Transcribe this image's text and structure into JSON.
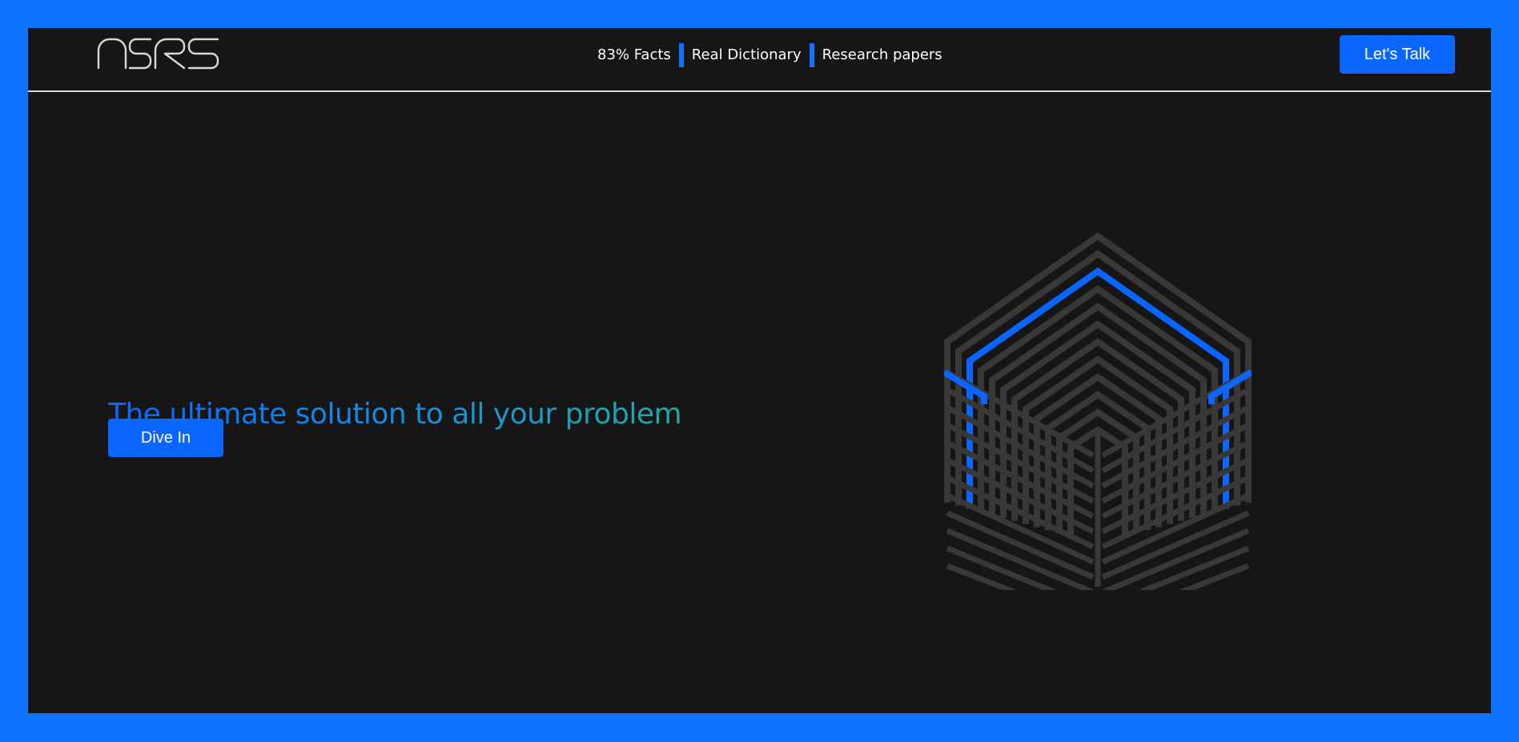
{
  "nav": {
    "logo_text": "NSRS",
    "links": [
      "83% Facts",
      "Real Dictionary",
      "Research papers"
    ],
    "cta_label": "Let's Talk"
  },
  "hero": {
    "headline": "The ultimate solution to all your problem",
    "button_label": "Dive In"
  },
  "colors": {
    "page_border": "#0f73ff",
    "background": "#161616",
    "accent_blue": "#0a66ff",
    "headline_gradient_start": "#0a66ff",
    "headline_gradient_end": "#25a8a3",
    "cube_stroke": "#3a3836"
  },
  "icons": {
    "cube_graphic": "isometric-line-cube-illustration"
  }
}
